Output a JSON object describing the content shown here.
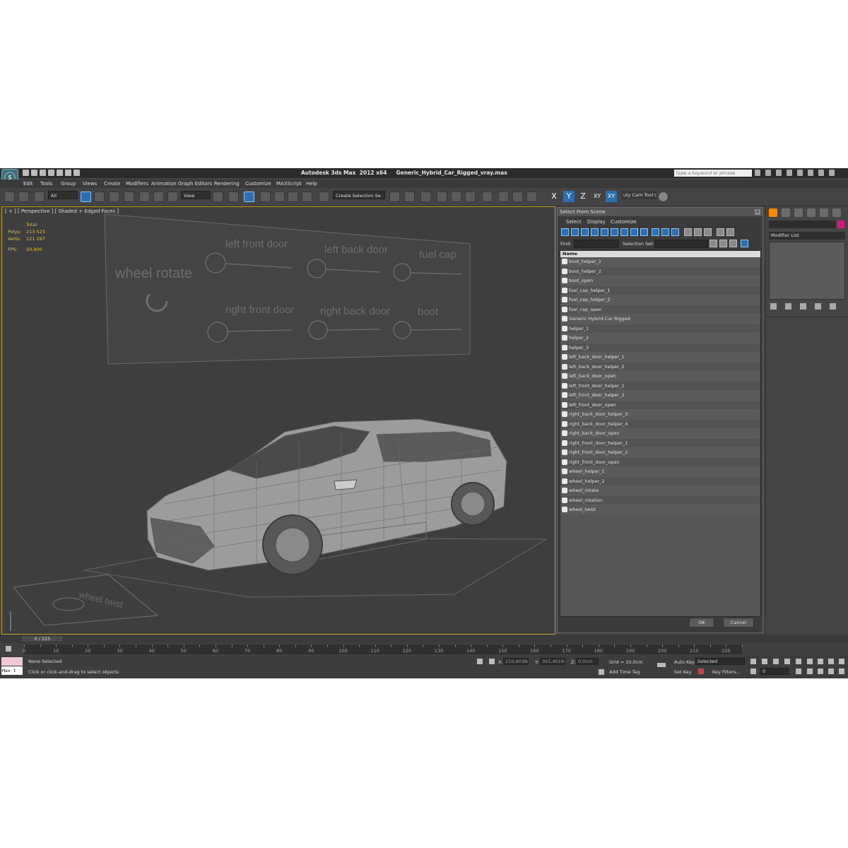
{
  "window": {
    "title": "Autodesk 3ds Max  2012 x64     Generic_Hybrid_Car_Rigged_vray.max",
    "search_placeholder": "Type a keyword or phrase"
  },
  "menu": [
    "Edit",
    "Tools",
    "Group",
    "Views",
    "Create",
    "Modifiers",
    "Animation",
    "Graph Editors",
    "Rendering",
    "Customize",
    "MAXScript",
    "Help"
  ],
  "toolbar": {
    "selection_filter": "All",
    "ref_coord": "View",
    "named_selection": "Create Selection Se",
    "axes": [
      "X",
      "Y",
      "Z",
      "XY",
      "XY"
    ],
    "cam_tool_label": "uty Cam Tool \\"
  },
  "viewport": {
    "label": "[ + ] [ Perspective ] [ Shaded + Edged Faces ]",
    "stats": {
      "total_label": "Total",
      "polys_label": "Polys:",
      "polys_value": "213 523",
      "verts_label": "Verts:",
      "verts_value": "121 297",
      "fps_label": "FPS:",
      "fps_value": "50,900"
    },
    "rig_labels": {
      "wheel_rotate": "wheel rotate",
      "left_front_door": "left front door",
      "left_back_door": "left back door",
      "fuel_cap": "fuel cap",
      "right_front_door": "right front door",
      "right_back_door": "right back door",
      "boot": "boot",
      "floor_wheel_twist": "wheel twist"
    }
  },
  "select_dialog": {
    "title": "Select From Scene",
    "close": "x",
    "menu": [
      "Select",
      "Display",
      "Customize"
    ],
    "find_label": "Find:",
    "selection_set_label": "Selection Set:",
    "column_name": "Name",
    "items": [
      "boot_helper_1",
      "boot_helper_2",
      "boot_open",
      "fuel_cap_helper_1",
      "fuel_cap_helper_2",
      "fuel_cap_open",
      "Generic Hybrid Car Rigged",
      "helper_1",
      "helper_2",
      "helper_3",
      "left_back_door_helper_1",
      "left_back_door_helper_2",
      "left_back_door_open",
      "left_front_door_helper_1",
      "left_front_door_helper_2",
      "left_front_door_open",
      "right_back_door_helper_3",
      "right_back_door_helper_4",
      "right_back_door_open",
      "right_front_door_helper_1",
      "right_front_door_helper_2",
      "right_front_door_open",
      "wheel_helper_1",
      "wheel_helper_2",
      "wheel_rotate",
      "wheel_rotation",
      "wheel_twist"
    ],
    "ok": "OK",
    "cancel": "Cancel"
  },
  "command_panel": {
    "modifier_list": "Modifier List",
    "object_color": "#d6197a"
  },
  "timeline": {
    "slider": "0 / 225",
    "ticks": [
      "0",
      "10",
      "20",
      "30",
      "40",
      "50",
      "60",
      "70",
      "80",
      "90",
      "100",
      "110",
      "120",
      "130",
      "140",
      "150",
      "160",
      "170",
      "180",
      "190",
      "200",
      "210",
      "220"
    ]
  },
  "status": {
    "maxscript": "Max t",
    "selection": "None Selected",
    "prompt": "Click or click-and-drag to select objects",
    "x_label": "X:",
    "x_value": "210,6038c",
    "y_label": "Y:",
    "y_value": "361,4018c",
    "z_label": "Z:",
    "z_value": "0,0cm",
    "grid": "Grid = 10,0cm",
    "add_time_tag": "Add Time Tag",
    "auto_key": "Auto Key",
    "key_mode": "Selected",
    "set_key": "Set Key",
    "key_filters": "Key Filters...",
    "frame": "0"
  }
}
